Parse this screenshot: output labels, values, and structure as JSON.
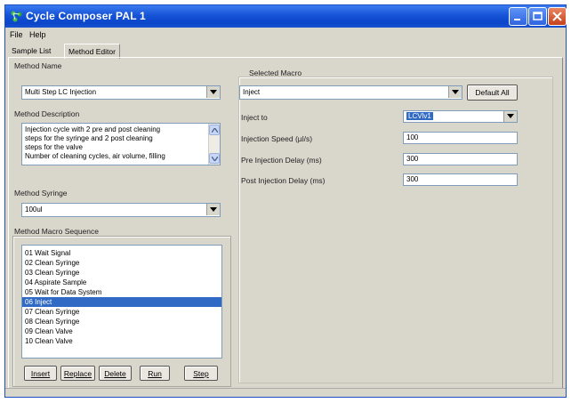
{
  "window": {
    "title": "Cycle Composer  PAL 1",
    "app_icon": "molecule-icon"
  },
  "menubar": {
    "items": [
      "File",
      "Help"
    ]
  },
  "tabs": [
    {
      "label": "Sample List",
      "active": false
    },
    {
      "label": "Method Editor",
      "active": true
    }
  ],
  "method_name": {
    "label": "Method Name",
    "value": "Multi Step LC Injection"
  },
  "method_description": {
    "label": "Method Description",
    "lines": [
      "Injection cycle with 2 pre and post cleaning",
      "steps for the syringe and 2 post cleaning",
      "steps for the valve",
      "Number of cleaning cycles, air volume, filling"
    ]
  },
  "method_syringe": {
    "label": "Method Syringe",
    "value": "100ul"
  },
  "macro_sequence": {
    "label": "Method Macro Sequence",
    "items": [
      "01 Wait Signal",
      "02 Clean Syringe",
      "03 Clean Syringe",
      "04 Aspirate Sample",
      "05 Wait for Data System",
      "06 Inject",
      "07 Clean Syringe",
      "08 Clean Syringe",
      "09 Clean Valve",
      "10 Clean Valve"
    ],
    "selected_index": 5,
    "buttons": {
      "insert": "Insert",
      "replace": "Replace",
      "delete": "Delete",
      "run": "Run",
      "step": "Step"
    }
  },
  "selected_macro": {
    "label": "Selected Macro",
    "value": "Inject",
    "default_all": "Default All",
    "params": [
      {
        "label": "Inject to",
        "value": "LCVlv1",
        "type": "combo"
      },
      {
        "label": "Injection Speed  (µl/s)",
        "value": "100",
        "type": "text"
      },
      {
        "label": "Pre Injection Delay  (ms)",
        "value": "300",
        "type": "text"
      },
      {
        "label": "Post Injection Delay  (ms)",
        "value": "300",
        "type": "text"
      }
    ]
  },
  "colors": {
    "titlebar": "#0b45c9",
    "selection": "#316ac5",
    "window_bg": "#d9d6cc"
  }
}
